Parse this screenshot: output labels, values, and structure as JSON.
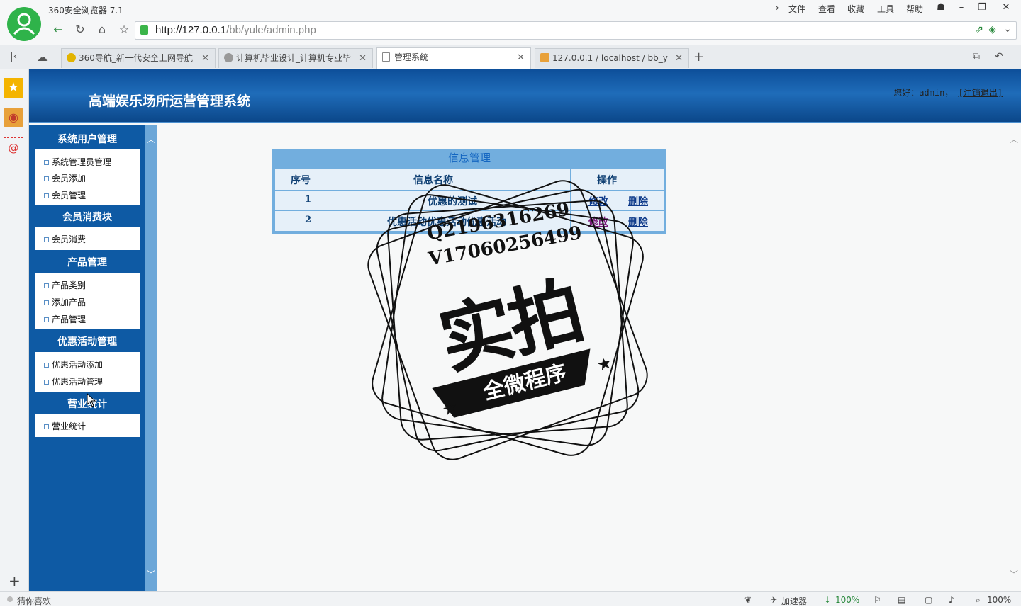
{
  "browser": {
    "app_name": "360安全浏览器 7.1",
    "menu": [
      "文件",
      "查看",
      "收藏",
      "工具",
      "帮助"
    ],
    "url_host": "http://127.0.0.1",
    "url_path": "/bb/yule/admin.php",
    "tabs": [
      {
        "label": "360导航_新一代安全上网导航",
        "active": false
      },
      {
        "label": "计算机毕业设计_计算机专业毕",
        "active": false
      },
      {
        "label": "管理系统",
        "active": true
      },
      {
        "label": "127.0.0.1 / localhost / bb_y",
        "active": false
      }
    ],
    "status": {
      "left": "猜你喜欢",
      "accelerator": "加速器",
      "download": "100%",
      "zoom": "100%"
    }
  },
  "site": {
    "title": "高端娱乐场所运营管理系统",
    "greeting": "您好：admin，",
    "logout": "[注销退出]"
  },
  "sidebar": {
    "sections": [
      {
        "title": "系统用户管理",
        "items": [
          "系统管理员管理",
          "会员添加",
          "会员管理"
        ]
      },
      {
        "title": "会员消费块",
        "items": [
          "会员消费"
        ]
      },
      {
        "title": "产品管理",
        "items": [
          "产品类别",
          "添加产品",
          "产品管理"
        ]
      },
      {
        "title": "优惠活动管理",
        "items": [
          "优惠活动添加",
          "优惠活动管理"
        ]
      },
      {
        "title": "营业统计",
        "items": [
          "营业统计"
        ]
      }
    ]
  },
  "table": {
    "title": "信息管理",
    "headers": [
      "序号",
      "信息名称",
      "操作"
    ],
    "rows": [
      {
        "no": "1",
        "name": "优惠的测试",
        "edit": "修改",
        "delete": "删除"
      },
      {
        "no": "2",
        "name": "优惠活动优惠活动优惠活动",
        "edit": "修改",
        "delete": "删除"
      }
    ]
  },
  "watermark": {
    "line1": "Q2196316269",
    "line2": "V17060256499",
    "big": "实拍",
    "banner": "全微程序"
  }
}
